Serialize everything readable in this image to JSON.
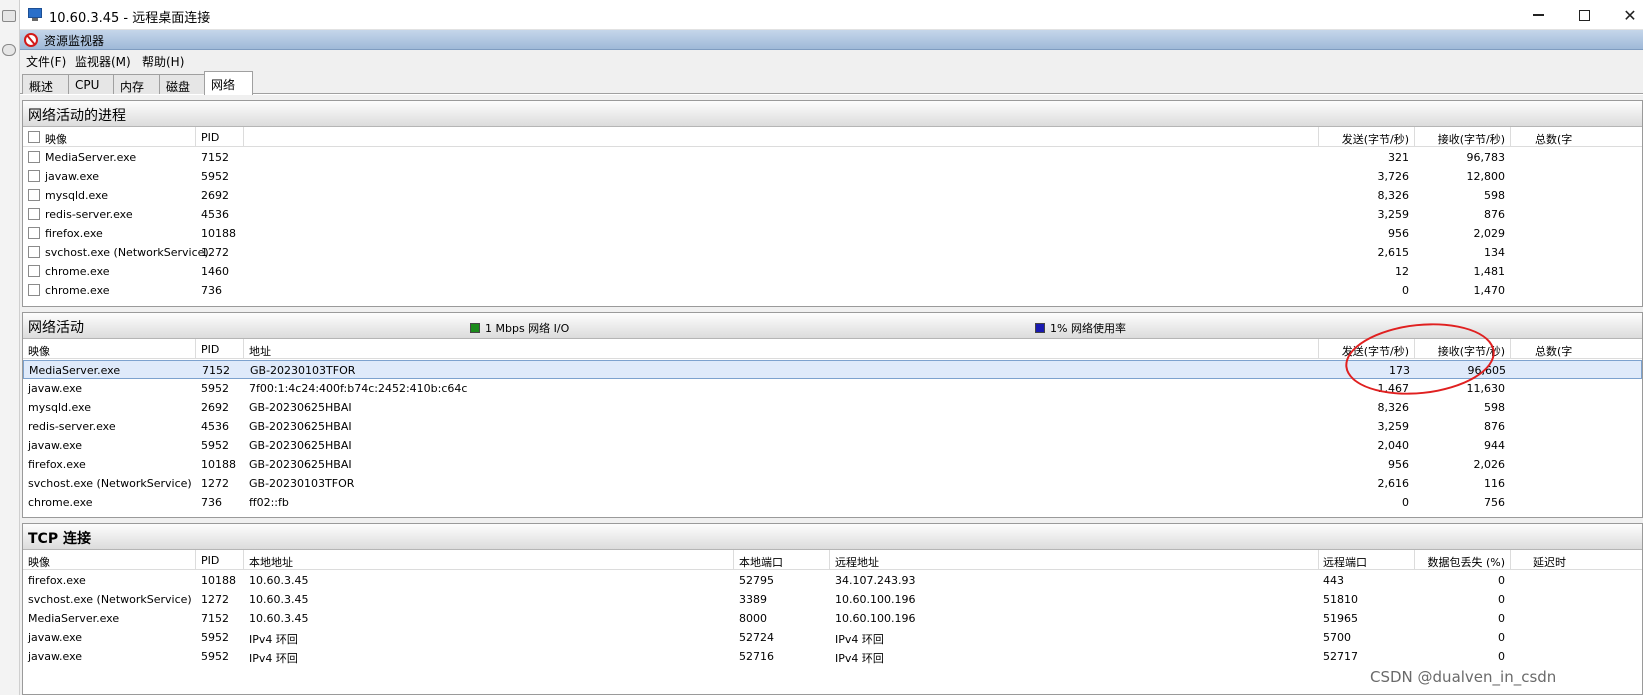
{
  "window": {
    "title": "10.60.3.45 - 远程桌面连接",
    "minimize": "—",
    "close": "✕"
  },
  "app": {
    "title": "资源监视器",
    "menu": [
      "文件(F)",
      "监视器(M)",
      "帮助(H)"
    ],
    "tabs": [
      "概述",
      "CPU",
      "内存",
      "磁盘",
      "网络"
    ],
    "active_tab": "网络"
  },
  "processes": {
    "title": "网络活动的进程",
    "columns": [
      "映像",
      "PID",
      "发送(字节/秒)",
      "接收(字节/秒)",
      "总数(字"
    ],
    "rows": [
      [
        "MediaServer.exe",
        "7152",
        "321",
        "96,783"
      ],
      [
        "javaw.exe",
        "5952",
        "3,726",
        "12,800"
      ],
      [
        "mysqld.exe",
        "2692",
        "8,326",
        "598"
      ],
      [
        "redis-server.exe",
        "4536",
        "3,259",
        "876"
      ],
      [
        "firefox.exe",
        "10188",
        "956",
        "2,029"
      ],
      [
        "svchost.exe (NetworkService)",
        "1272",
        "2,615",
        "134"
      ],
      [
        "chrome.exe",
        "1460",
        "12",
        "1,481"
      ],
      [
        "chrome.exe",
        "736",
        "0",
        "1,470"
      ]
    ]
  },
  "activity": {
    "title": "网络活动",
    "legend_io": "1 Mbps 网络 I/O",
    "legend_usage": "1% 网络使用率",
    "io_color": "#1a8a1a",
    "usage_color": "#1a1ab0",
    "columns": [
      "映像",
      "PID",
      "地址",
      "发送(字节/秒)",
      "接收(字节/秒)",
      "总数(字"
    ],
    "rows": [
      [
        "MediaServer.exe",
        "7152",
        "GB-20230103TFOR",
        "173",
        "96,605"
      ],
      [
        "javaw.exe",
        "5952",
        "7f00:1:4c24:400f:b74c:2452:410b:c64c",
        "1,467",
        "11,630"
      ],
      [
        "mysqld.exe",
        "2692",
        "GB-20230625HBAI",
        "8,326",
        "598"
      ],
      [
        "redis-server.exe",
        "4536",
        "GB-20230625HBAI",
        "3,259",
        "876"
      ],
      [
        "javaw.exe",
        "5952",
        "GB-20230625HBAI",
        "2,040",
        "944"
      ],
      [
        "firefox.exe",
        "10188",
        "GB-20230625HBAI",
        "956",
        "2,026"
      ],
      [
        "svchost.exe (NetworkService)",
        "1272",
        "GB-20230103TFOR",
        "2,616",
        "116"
      ],
      [
        "chrome.exe",
        "736",
        "ff02::fb",
        "0",
        "756"
      ]
    ]
  },
  "tcp": {
    "title": "TCP 连接",
    "columns": [
      "映像",
      "PID",
      "本地地址",
      "本地端口",
      "远程地址",
      "远程端口",
      "数据包丢失 (%)",
      "延迟时"
    ],
    "rows": [
      [
        "firefox.exe",
        "10188",
        "10.60.3.45",
        "52795",
        "34.107.243.93",
        "443",
        "0"
      ],
      [
        "svchost.exe (NetworkService)",
        "1272",
        "10.60.3.45",
        "3389",
        "10.60.100.196",
        "51810",
        "0"
      ],
      [
        "MediaServer.exe",
        "7152",
        "10.60.3.45",
        "8000",
        "10.60.100.196",
        "51965",
        "0"
      ],
      [
        "javaw.exe",
        "5952",
        "IPv4 环回",
        "52724",
        "IPv4 环回",
        "5700",
        "0"
      ],
      [
        "javaw.exe",
        "5952",
        "IPv4 环回",
        "52716",
        "IPv4 环回",
        "52717",
        "0"
      ]
    ]
  },
  "watermark": "CSDN @dualven_in_csdn"
}
